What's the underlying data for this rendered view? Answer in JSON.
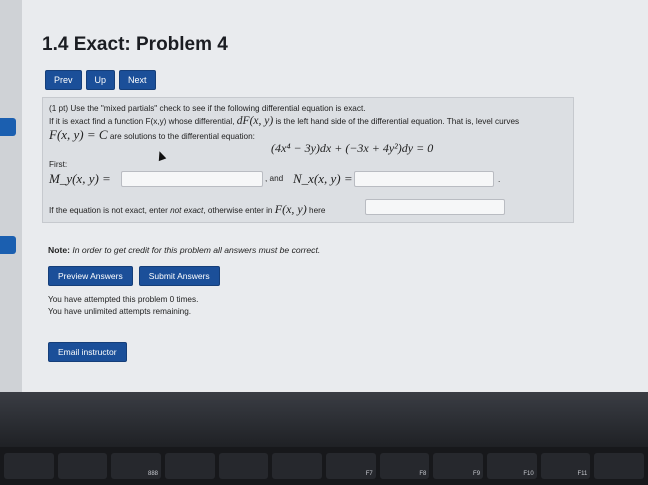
{
  "title": "1.4 Exact: Problem 4",
  "nav": {
    "prev": "Prev",
    "up": "Up",
    "next": "Next"
  },
  "problem": {
    "line1": "(1 pt) Use the \"mixed partials\" check to see if the following differential equation is exact.",
    "line2a": "If it is exact find a function F(x,y) whose differential, ",
    "line2_math": "dF(x, y)",
    "line2b": " is the left hand side of the differential equation. That is, level curves",
    "line3_math": "F(x, y) = C",
    "line3b": " are solutions to the differential equation:",
    "equation": "(4x⁴ − 3y)dx + (−3x + 4y²)dy = 0",
    "first_label": "First:",
    "my_label": "M_y(x, y) =",
    "my_value": "",
    "and_label": ", and",
    "nx_label": "N_x(x, y) =",
    "nx_value": "",
    "trailing_period": ".",
    "exact_text_a": "If the equation is not exact, enter ",
    "exact_text_em": "not exact",
    "exact_text_b": ", otherwise enter in ",
    "exact_math": "F(x, y)",
    "exact_text_c": " here",
    "exact_value": ""
  },
  "note": {
    "label": "Note:",
    "text": " In order to get credit for this problem all answers must be correct."
  },
  "actions": {
    "preview": "Preview Answers",
    "submit": "Submit Answers"
  },
  "status": {
    "attempts": "You have attempted this problem 0 times.",
    "remaining": "You have unlimited attempts remaining."
  },
  "email": "Email instructor",
  "keyboard": [
    "",
    "",
    "888",
    "",
    "",
    "",
    "F7",
    "F8",
    "F9",
    "F10",
    "F11",
    ""
  ]
}
